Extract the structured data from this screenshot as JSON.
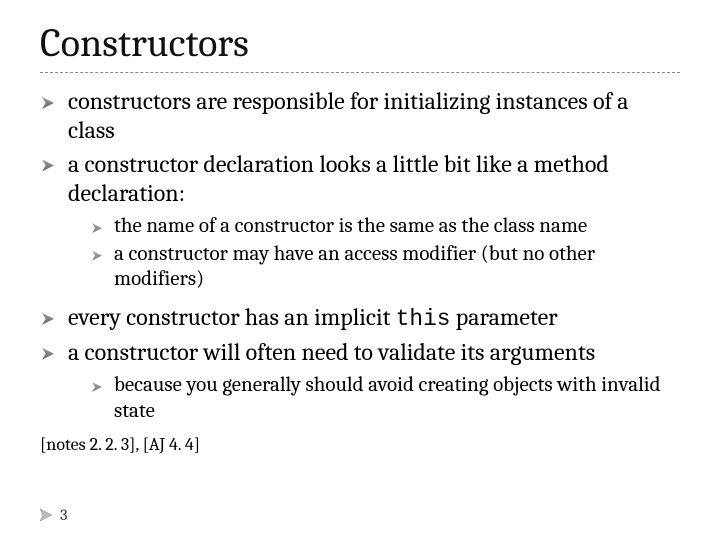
{
  "title": "Constructors",
  "bullets": {
    "b1": "constructors are responsible for initializing instances of a class",
    "b2": "a constructor declaration looks a little bit like a method declaration:",
    "b2_sub1": "the name of a constructor is the same as the class name",
    "b2_sub2": "a constructor may have an access modifier (but no other modifiers)",
    "b3_pre": "every constructor has an implicit ",
    "b3_code": "this",
    "b3_post": " parameter",
    "b4": "a constructor will often need to validate its arguments",
    "b4_sub1": "because you generally should avoid creating objects with invalid state"
  },
  "refs": "[notes 2. 2. 3], [AJ 4. 4]",
  "page_number": "3"
}
